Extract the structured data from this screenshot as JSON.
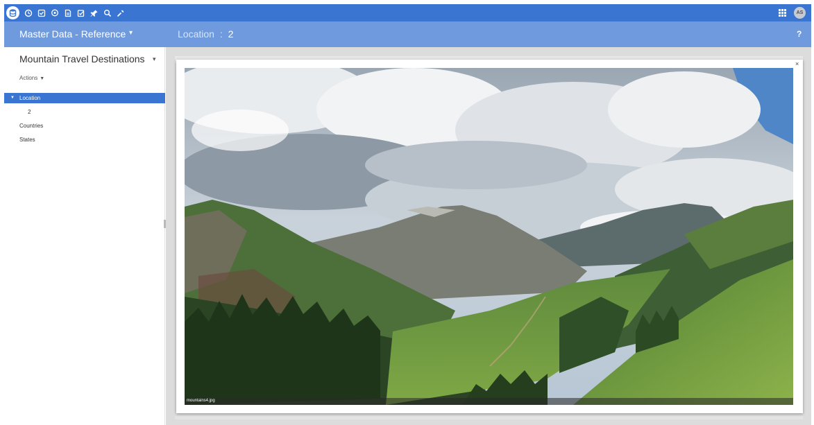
{
  "toolbar": {
    "icons": [
      "database-icon",
      "clock-icon",
      "checklist-icon",
      "chat-icon",
      "stacked-docs-icon",
      "edit-check-icon",
      "pin-icon",
      "search-icon",
      "wrench-icon"
    ],
    "apps_icon": "grid-icon",
    "avatar_initials": "AS",
    "bg_color": "#3a76d1"
  },
  "header": {
    "section_title": "Master Data - Reference",
    "location_label": "Location",
    "location_separator": ":",
    "location_value": "2",
    "help_label": "?"
  },
  "sidebar": {
    "title": "Mountain Travel Destinations",
    "actions_label": "Actions",
    "tree": [
      {
        "label": "Location",
        "expanded": true,
        "selected": true,
        "level": 0
      },
      {
        "label": "2",
        "selected": false,
        "level": 1
      },
      {
        "label": "Countries",
        "selected": false,
        "level": 0
      },
      {
        "label": "States",
        "selected": false,
        "level": 0
      }
    ]
  },
  "modal": {
    "close_label": "×",
    "image_caption": "mountains4.jpg",
    "image_subject": "mountain-valley-landscape"
  }
}
